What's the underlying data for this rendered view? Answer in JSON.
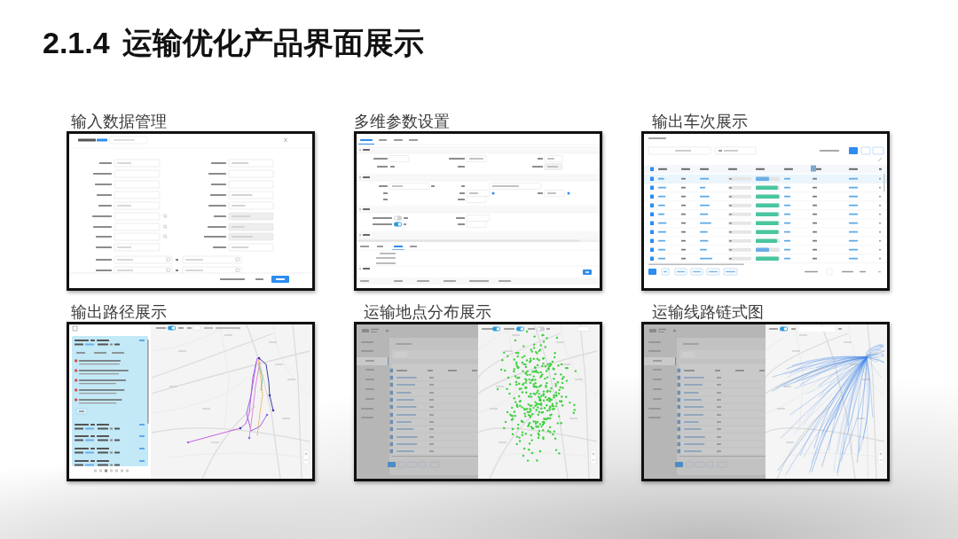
{
  "title": {
    "number": "2.1.4",
    "text": "运输优化产品界面展示"
  },
  "panels": [
    {
      "caption": "输入数据管理",
      "kind": "form"
    },
    {
      "caption": "多维参数设置",
      "kind": "settings"
    },
    {
      "caption": "输出车次展示",
      "kind": "table"
    },
    {
      "caption": "输出路径展示",
      "kind": "route-map"
    },
    {
      "caption": "运输地点分布展示",
      "kind": "point-map"
    },
    {
      "caption": "运输线路链式图",
      "kind": "flow-map"
    }
  ]
}
